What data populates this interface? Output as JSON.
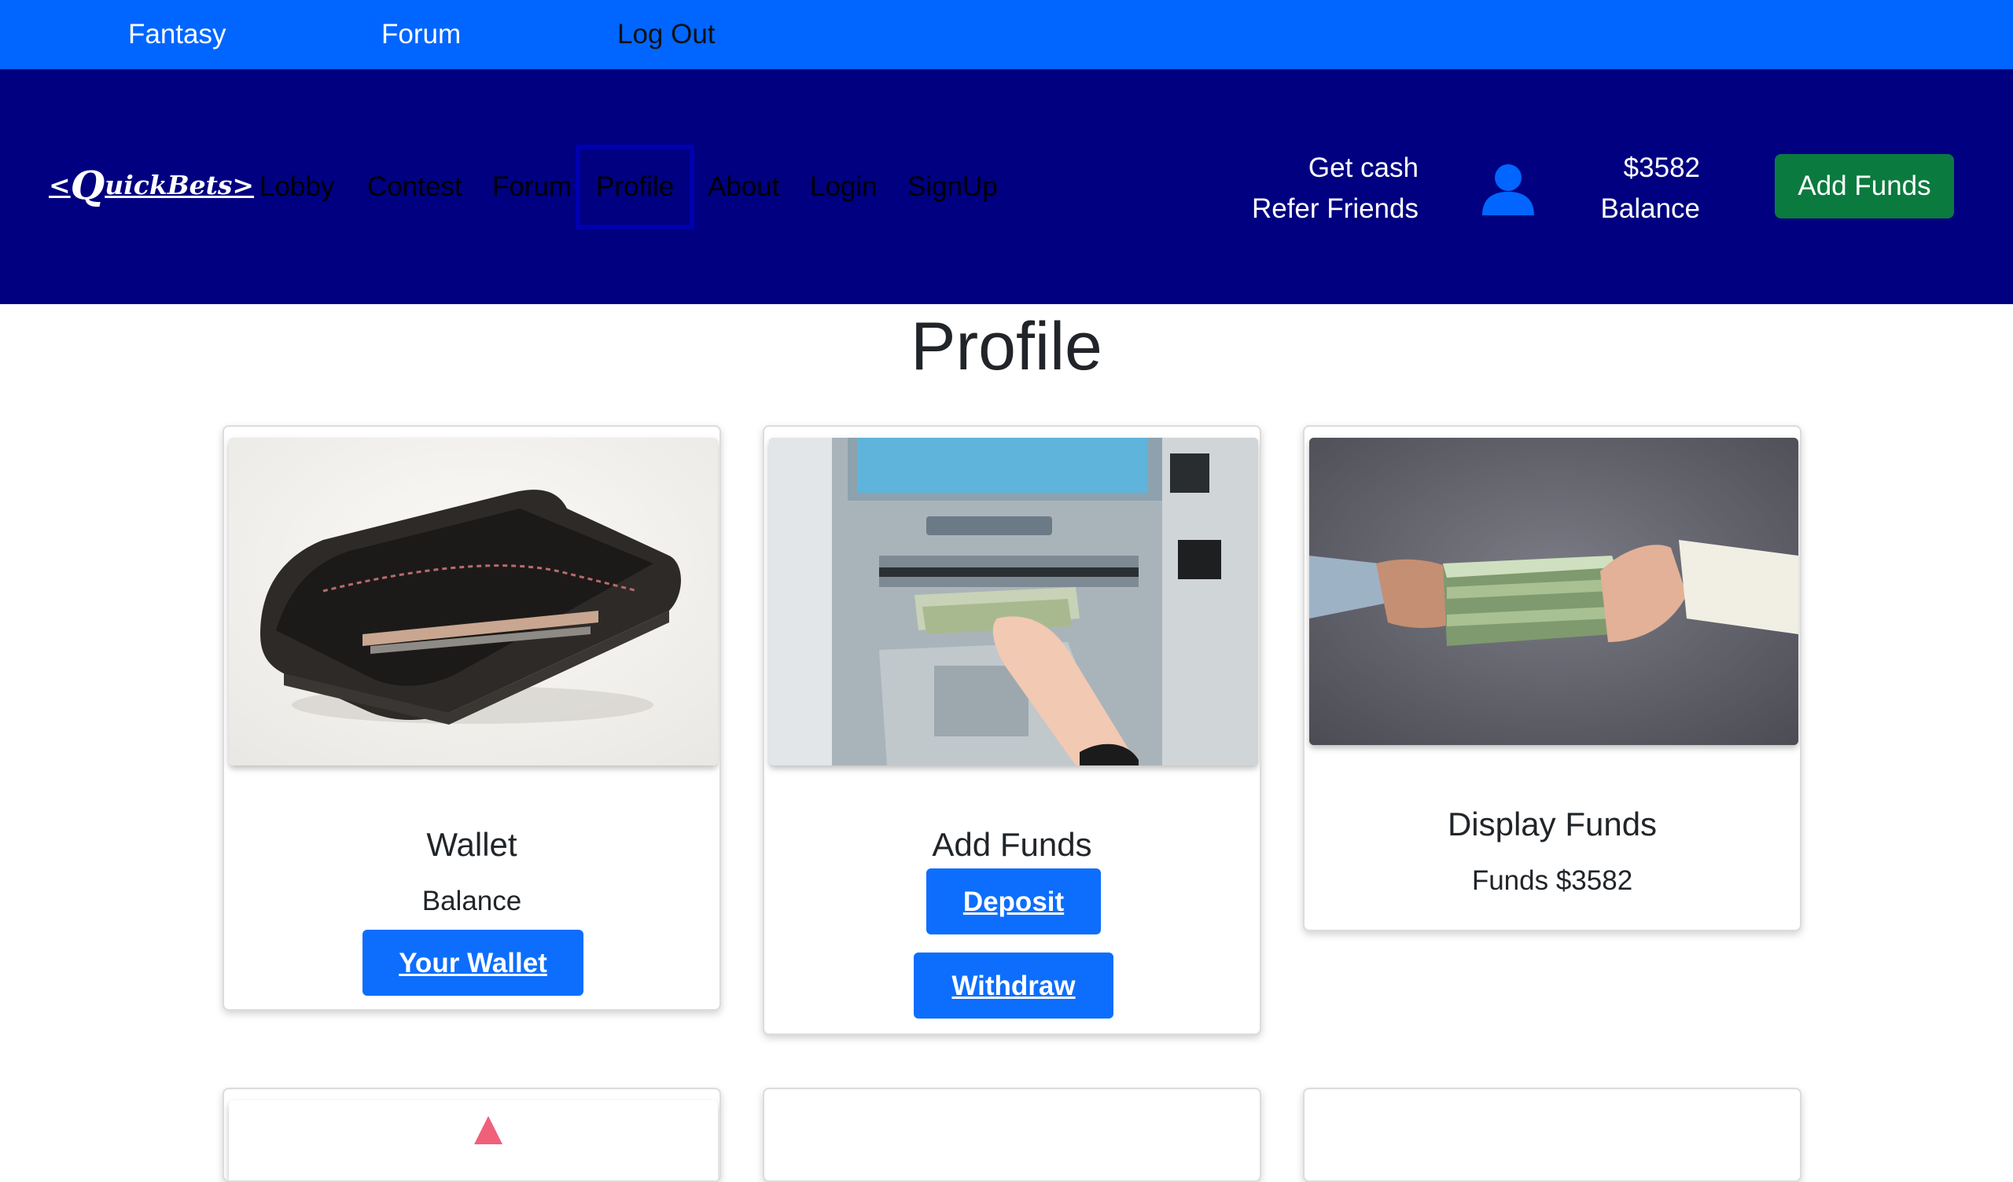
{
  "topbar": {
    "links": [
      "Fantasy",
      "Forum",
      "Log Out"
    ]
  },
  "navbar": {
    "brand": {
      "q": "Q",
      "rest": "uickBets",
      "left": "<",
      "right": ">"
    },
    "links": [
      "Lobby",
      "Contest",
      "Forum",
      "Profile",
      "About",
      "Login",
      "SignUp"
    ],
    "active": "Profile",
    "promo": {
      "line1": "Get cash",
      "line2": "Refer Friends"
    },
    "user_icon": "user-icon",
    "balance": {
      "amount": "$3582",
      "label": "Balance"
    },
    "add_funds_label": "Add Funds"
  },
  "page": {
    "title": "Profile"
  },
  "cards": {
    "wallet": {
      "image": "wallet-photo",
      "title": "Wallet",
      "text": "Balance",
      "button": "Your Wallet"
    },
    "add_funds": {
      "image": "atm-photo",
      "title": "Add Funds",
      "deposit": "Deposit",
      "withdraw": "Withdraw"
    },
    "display_funds": {
      "image": "cash-handoff-photo",
      "title": "Display Funds",
      "text": "Funds $3582"
    }
  },
  "colors": {
    "topbar": "#0066ff",
    "navbar": "#000080",
    "add_funds_button": "#0b7a3e",
    "primary_button": "#0d6efd",
    "user_icon": "#0066ff"
  }
}
